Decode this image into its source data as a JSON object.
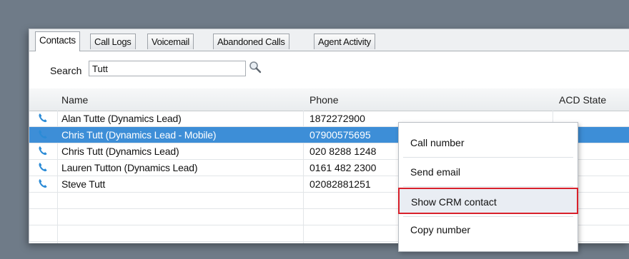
{
  "tabs": [
    {
      "label": "Contacts",
      "active": true
    },
    {
      "label": "Call Logs",
      "active": false
    },
    {
      "label": "Voicemail",
      "active": false
    },
    {
      "label": "Abandoned Calls",
      "active": false
    },
    {
      "label": "Agent Activity",
      "active": false
    }
  ],
  "search": {
    "label": "Search",
    "value": "Tutt",
    "placeholder": ""
  },
  "columns": {
    "name": "Name",
    "phone": "Phone",
    "acd_state": "ACD State"
  },
  "rows": [
    {
      "name": "Alan Tutte (Dynamics Lead)",
      "phone": "1872272900"
    },
    {
      "name": "Chris Tutt (Dynamics Lead - Mobile)",
      "phone": "07900575695"
    },
    {
      "name": "Chris Tutt (Dynamics Lead)",
      "phone": "020 8288 1248"
    },
    {
      "name": "Lauren Tutton (Dynamics Lead)",
      "phone": "0161 482 2300"
    },
    {
      "name": "Steve Tutt",
      "phone": "02082881251"
    }
  ],
  "selected_row": 1,
  "context_menu": {
    "items": [
      {
        "label": "Call number"
      },
      {
        "label": "Send email"
      },
      {
        "label": "Show CRM contact"
      },
      {
        "label": "Copy number"
      }
    ]
  },
  "colors": {
    "selection": "#3d8ed7",
    "highlight_border": "#d8202b",
    "phone_icon": "#2b8bd6"
  },
  "icons": {
    "search": "magnifier-icon",
    "row": "phone-handset-icon"
  }
}
